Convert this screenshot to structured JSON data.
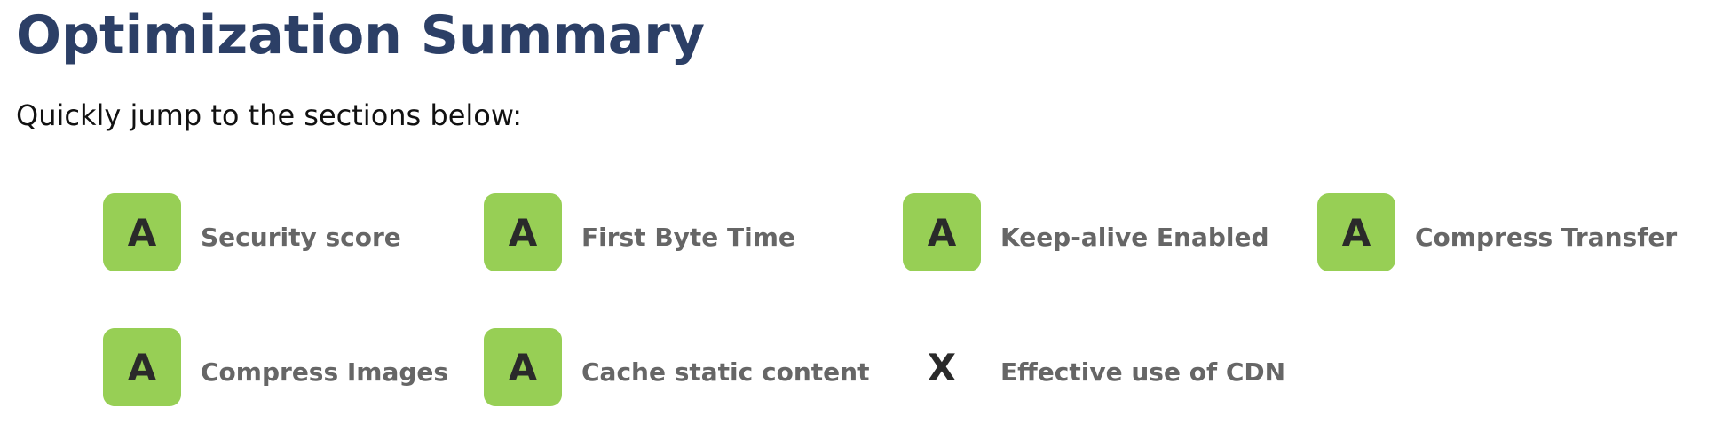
{
  "header": {
    "title": "Optimization Summary",
    "subtitle": "Quickly jump to the sections below:"
  },
  "colors": {
    "title": "#2c3f66",
    "badge_green": "#97cf55",
    "label_gray": "#666666"
  },
  "items": [
    {
      "grade": "A",
      "label": "Security score"
    },
    {
      "grade": "A",
      "label": "First Byte Time"
    },
    {
      "grade": "A",
      "label": "Keep-alive Enabled"
    },
    {
      "grade": "A",
      "label": "Compress Transfer"
    },
    {
      "grade": "A",
      "label": "Compress Images"
    },
    {
      "grade": "A",
      "label": "Cache static content"
    },
    {
      "grade": "X",
      "label": "Effective use of CDN"
    }
  ]
}
